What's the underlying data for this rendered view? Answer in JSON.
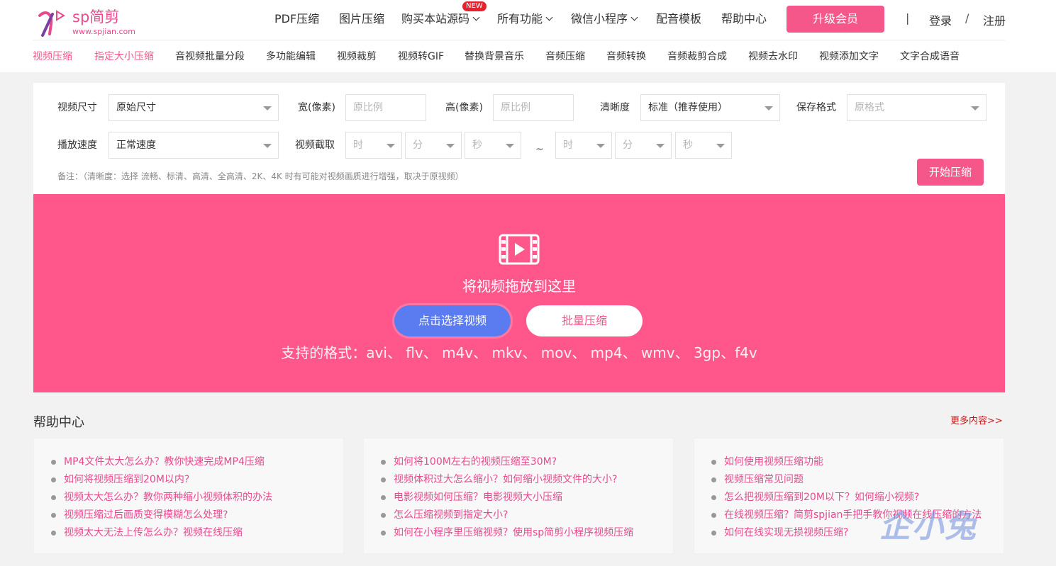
{
  "header": {
    "brand": "sp简剪",
    "url": "www.spjian.com",
    "nav": {
      "pdf": "PDF压缩",
      "image": "图片压缩",
      "source": "购买本站源码",
      "new_badge": "NEW",
      "all_features": "所有功能",
      "mini_program": "微信小程序",
      "dubbing": "配音模板",
      "help": "帮助中心"
    },
    "upgrade": "升级会员",
    "separator1": "|",
    "login": "登录",
    "separator2": "/",
    "register": "注册"
  },
  "subnav": [
    "视频压缩",
    "指定大小压缩",
    "音视频批量分段",
    "多功能编辑",
    "视频裁剪",
    "视频转GIF",
    "替换背景音乐",
    "音频压缩",
    "音频转换",
    "音频裁剪合成",
    "视频去水印",
    "视频添加文字",
    "文字合成语音"
  ],
  "options": {
    "video_size_label": "视频尺寸",
    "video_size_value": "原始尺寸",
    "width_label": "宽(像素)",
    "width_placeholder": "原比例",
    "height_label": "高(像素)",
    "height_placeholder": "原比例",
    "clarity_label": "清晰度",
    "clarity_value": "标准（推荐使用）",
    "format_label": "保存格式",
    "format_placeholder": "原格式",
    "speed_label": "播放速度",
    "speed_value": "正常速度",
    "cut_label": "视频截取",
    "hour": "时",
    "minute": "分",
    "second": "秒",
    "tilde": "~",
    "note": "备注：（清晰度：选择 流畅、标清、高清、全高清、2K、4K 时有可能对视频画质进行增强，取决于原视频）",
    "start": "开始压缩"
  },
  "dropzone": {
    "text": "将视频拖放到这里",
    "select": "点击选择视频",
    "batch": "批量压缩",
    "formats": "支持的格式：avi、 flv、 m4v、 mkv、 mov、 mp4、 wmv、 3gp、f4v"
  },
  "help": {
    "title": "帮助中心",
    "more": "更多内容>>",
    "columns": [
      [
        "MP4文件太大怎么办？教你快速完成MP4压缩",
        "如何将视频压缩到20M以内?",
        "视频太大怎么办？教你两种缩小视频体积的办法",
        "视频压缩过后画质变得模糊怎么处理?",
        "视频太大无法上传怎么办？视频在线压缩"
      ],
      [
        "如何将100M左右的视频压缩至30M?",
        "视频体积过大怎么缩小？如何缩小视频文件的大小?",
        "电影视频如何压缩？电影视频大小压缩",
        "怎么压缩视频到指定大小?",
        "如何在小程序里压缩视频？使用sp简剪小程序视频压缩"
      ],
      [
        "如何使用视频压缩功能",
        "视频压缩常见问题",
        "怎么把视频压缩到20M以下？如何缩小视频?",
        "在线视频压缩？简剪spjian手把手教你视频在线压缩的方法",
        "如何在线实现无损视频压缩?"
      ]
    ]
  },
  "watermark": "企小兔",
  "colors": {
    "accent": "#f5578a",
    "dropzone": "#ff578c",
    "select_button": "#5b7bf0",
    "badge": "#e8212f"
  }
}
